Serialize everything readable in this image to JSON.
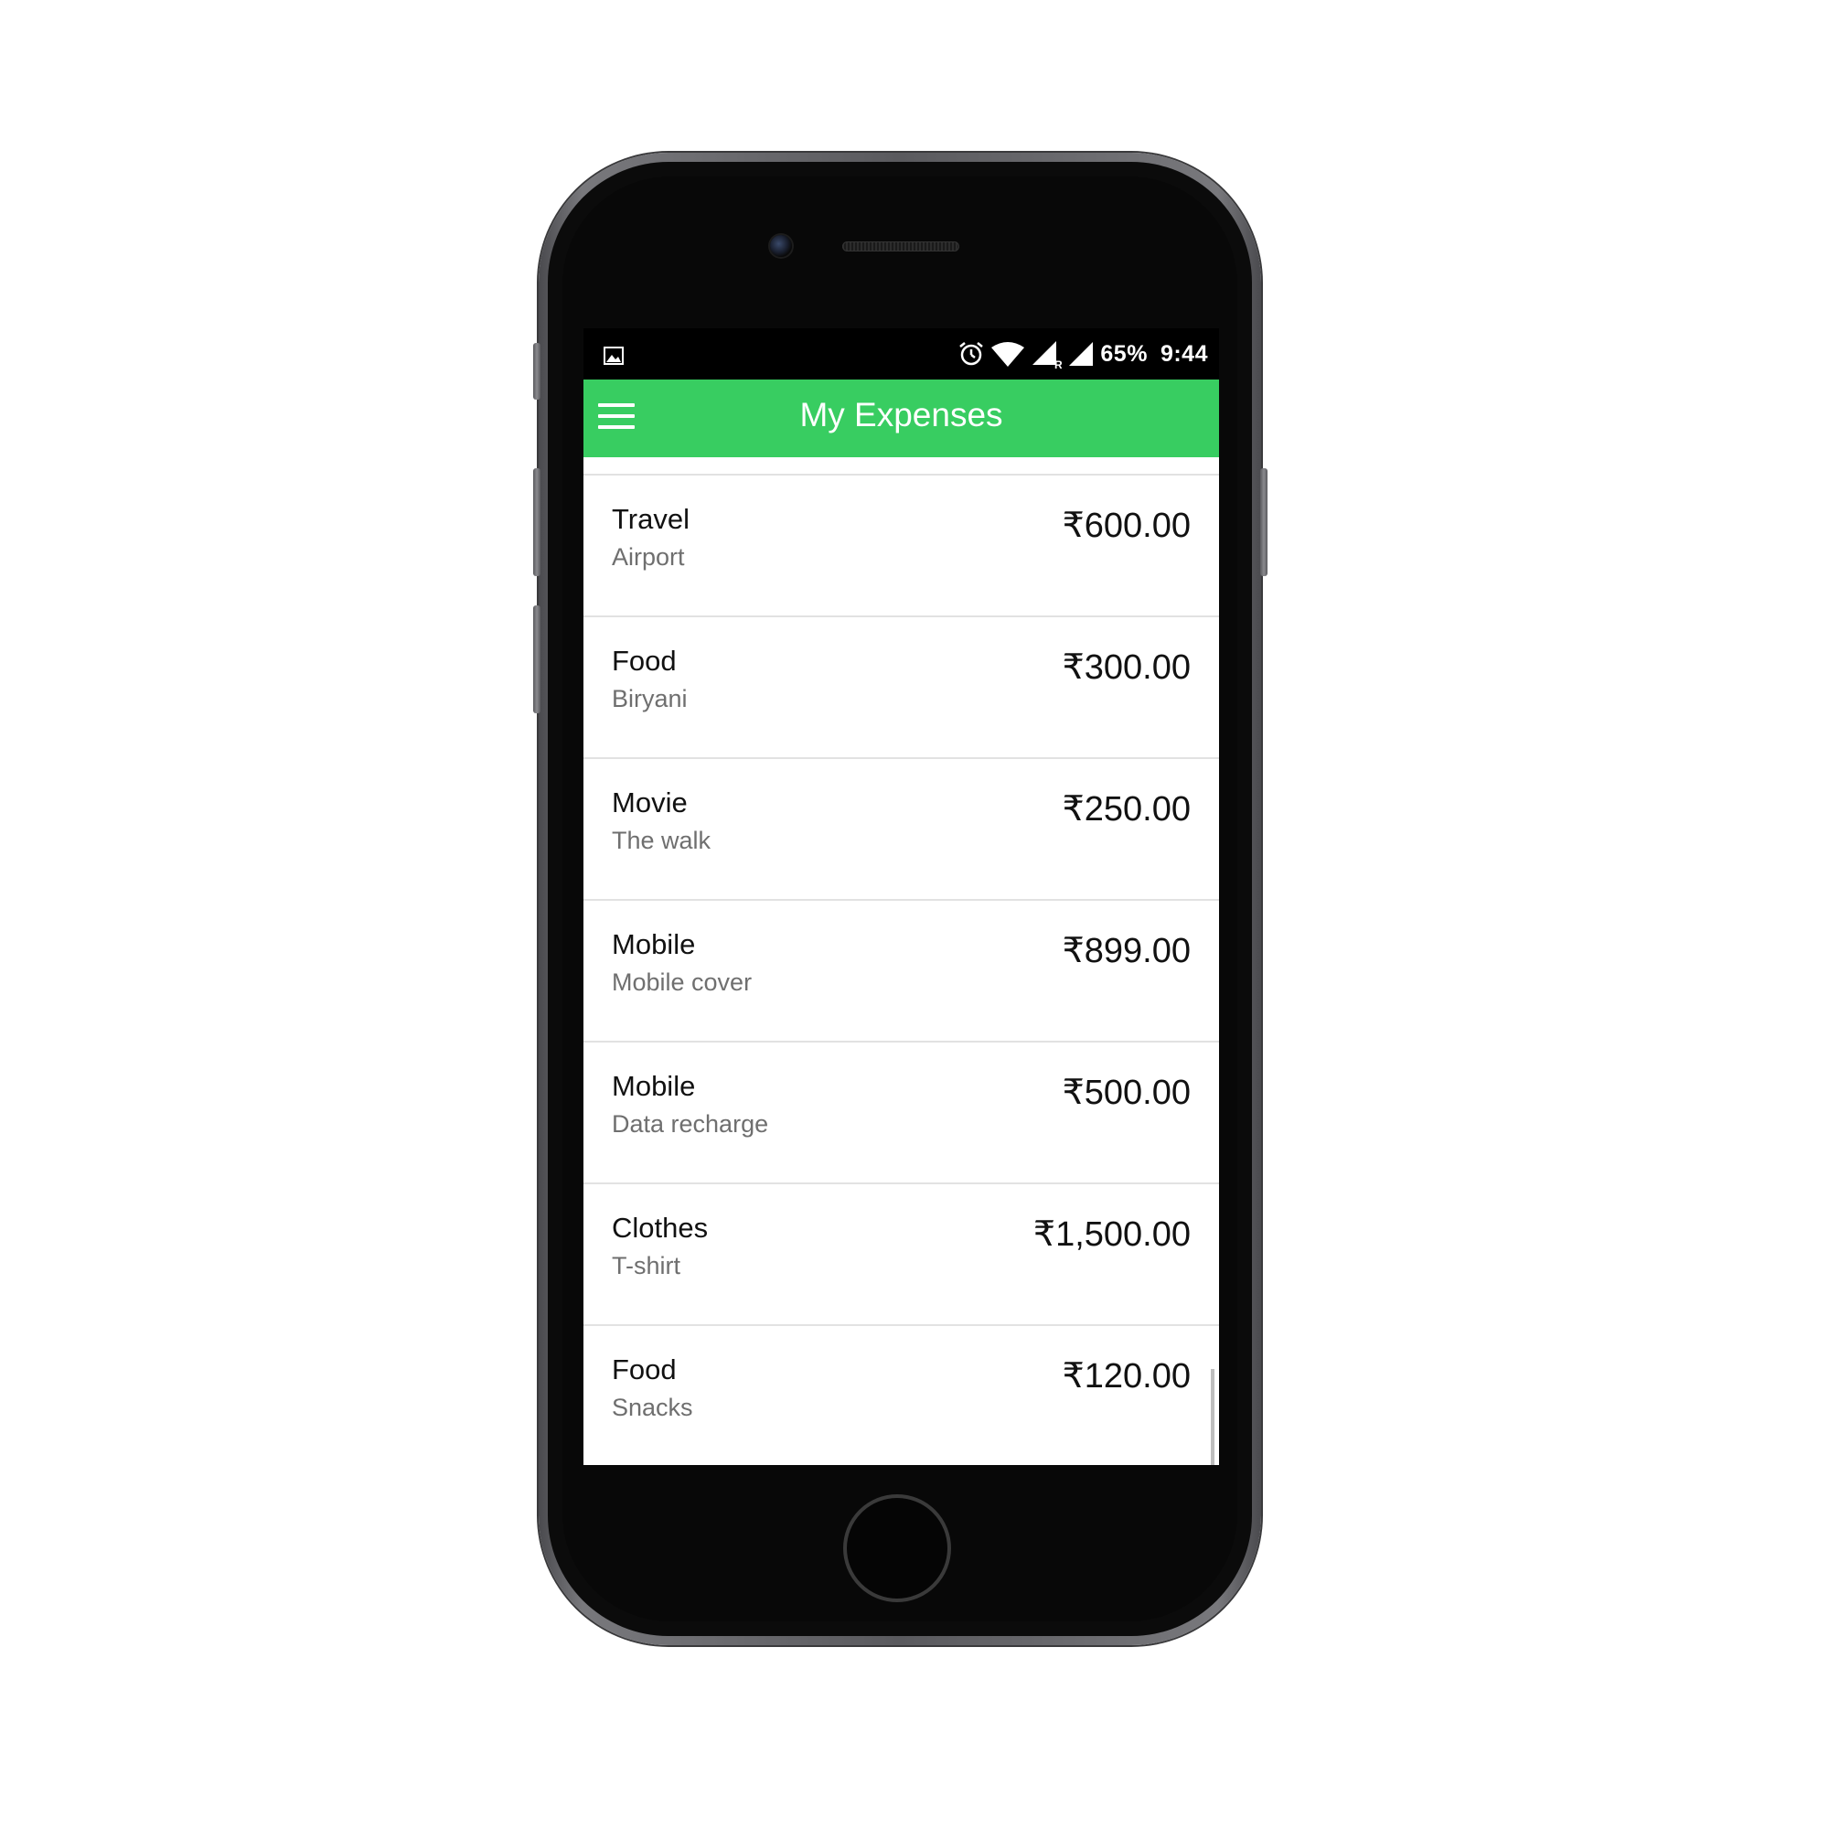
{
  "status_bar": {
    "battery": "65%",
    "time": "9:44",
    "network_badge": "R",
    "icons": [
      "image-notification-icon",
      "alarm-icon",
      "wifi-icon",
      "cell-signal-icon",
      "cell-signal-icon"
    ]
  },
  "app_bar": {
    "title": "My Expenses",
    "menu_icon": "hamburger-menu-icon",
    "color": "#38cd61"
  },
  "expenses": [
    {
      "category": "Travel",
      "description": "Airport",
      "amount": "₹600.00"
    },
    {
      "category": "Food",
      "description": "Biryani",
      "amount": "₹300.00"
    },
    {
      "category": "Movie",
      "description": "The walk",
      "amount": "₹250.00"
    },
    {
      "category": "Mobile",
      "description": "Mobile cover",
      "amount": "₹899.00"
    },
    {
      "category": "Mobile",
      "description": "Data recharge",
      "amount": "₹500.00"
    },
    {
      "category": "Clothes",
      "description": "T-shirt",
      "amount": "₹1,500.00"
    },
    {
      "category": "Food",
      "description": "Snacks",
      "amount": "₹120.00"
    }
  ]
}
